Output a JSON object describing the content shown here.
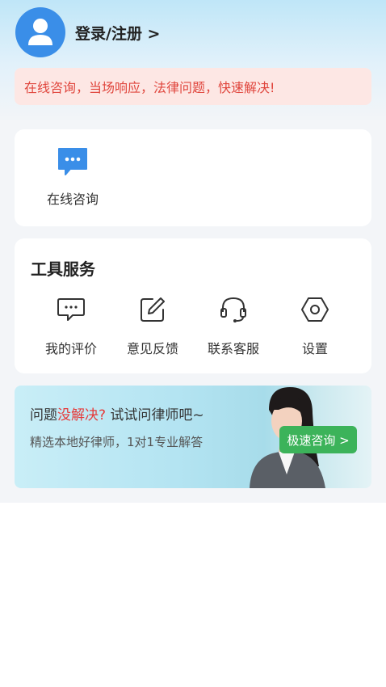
{
  "header": {
    "login_label": "登录/注册 >"
  },
  "notice": {
    "text": "在线咨询，当场响应，法律问题，快速解决!"
  },
  "consult": {
    "label": "在线咨询",
    "icon": "chat-bubble-icon"
  },
  "tools": {
    "title": "工具服务",
    "items": [
      {
        "label": "我的评价",
        "icon": "comment-icon"
      },
      {
        "label": "意见反馈",
        "icon": "edit-icon"
      },
      {
        "label": "联系客服",
        "icon": "headset-icon"
      },
      {
        "label": "设置",
        "icon": "settings-icon"
      }
    ]
  },
  "banner": {
    "title_prefix": "问题",
    "title_highlight": "没解决?",
    "title_suffix": " 试试问律师吧~",
    "subtitle": "精选本地好律师，1对1专业解答",
    "button_label": "极速咨询 >"
  },
  "colors": {
    "accent_blue": "#3a8ee8",
    "notice_red": "#e0463d",
    "notice_bg": "#fde7e4",
    "button_green": "#3cb35a"
  }
}
